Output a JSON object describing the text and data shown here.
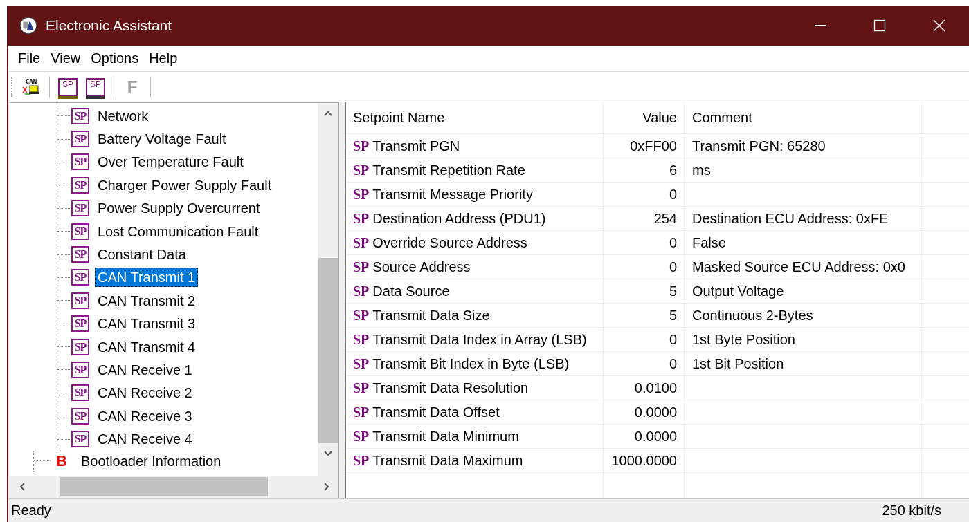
{
  "window": {
    "title": "Electronic Assistant"
  },
  "menu": [
    "File",
    "View",
    "Options",
    "Help"
  ],
  "toolbar": [
    {
      "kind": "connect",
      "label": "CAN",
      "disabled": false
    },
    {
      "kind": "open",
      "label": "SP",
      "disabled": false
    },
    {
      "kind": "save",
      "label": "SP",
      "disabled": false
    },
    {
      "kind": "letter",
      "label": "F",
      "disabled": true
    }
  ],
  "tree": {
    "items": [
      {
        "children": [
          {
            "badge": "SP",
            "kind": "setpoint",
            "label": "Network",
            "selected": false
          },
          {
            "badge": "SP",
            "kind": "setpoint",
            "label": "Battery Voltage Fault",
            "selected": false
          },
          {
            "badge": "SP",
            "kind": "setpoint",
            "label": "Over Temperature Fault",
            "selected": false
          },
          {
            "badge": "SP",
            "kind": "setpoint",
            "label": "Charger Power Supply Fault",
            "selected": false
          },
          {
            "badge": "SP",
            "kind": "setpoint",
            "label": "Power Supply Overcurrent",
            "selected": false
          },
          {
            "badge": "SP",
            "kind": "setpoint",
            "label": "Lost Communication Fault",
            "selected": false
          },
          {
            "badge": "SP",
            "kind": "setpoint",
            "label": "Constant Data",
            "selected": false
          },
          {
            "badge": "SP",
            "kind": "setpoint",
            "label": "CAN Transmit 1",
            "selected": true
          },
          {
            "badge": "SP",
            "kind": "setpoint",
            "label": "CAN Transmit 2",
            "selected": false
          },
          {
            "badge": "SP",
            "kind": "setpoint",
            "label": "CAN Transmit 3",
            "selected": false
          },
          {
            "badge": "SP",
            "kind": "setpoint",
            "label": "CAN Transmit 4",
            "selected": false
          },
          {
            "badge": "SP",
            "kind": "setpoint",
            "label": "CAN Receive 1",
            "selected": false
          },
          {
            "badge": "SP",
            "kind": "setpoint",
            "label": "CAN Receive 2",
            "selected": false
          },
          {
            "badge": "SP",
            "kind": "setpoint",
            "label": "CAN Receive 3",
            "selected": false
          },
          {
            "badge": "SP",
            "kind": "setpoint",
            "label": "CAN Receive 4",
            "selected": false
          }
        ]
      },
      {
        "badge": "B",
        "kind": "bootloader",
        "label": "Bootloader Information",
        "selected": false
      }
    ]
  },
  "table": {
    "columns": [
      "Setpoint Name",
      "Value",
      "Comment"
    ],
    "rows": [
      {
        "badge": "SP",
        "name": "Transmit PGN",
        "value": "0xFF00",
        "comment": "Transmit PGN: 65280"
      },
      {
        "badge": "SP",
        "name": "Transmit Repetition Rate",
        "value": "6",
        "comment": "ms"
      },
      {
        "badge": "SP",
        "name": "Transmit Message Priority",
        "value": "0"
      },
      {
        "badge": "SP",
        "name": "Destination Address (PDU1)",
        "value": "254",
        "comment": "Destination ECU Address: 0xFE"
      },
      {
        "badge": "SP",
        "name": "Override Source Address",
        "value": "0",
        "comment": "False"
      },
      {
        "badge": "SP",
        "name": "Source Address",
        "value": "0",
        "comment": "Masked Source ECU Address: 0x0"
      },
      {
        "badge": "SP",
        "name": "Data Source",
        "value": "5",
        "comment": "Output Voltage"
      },
      {
        "badge": "SP",
        "name": "Transmit Data Size",
        "value": "5",
        "comment": "Continuous 2-Bytes"
      },
      {
        "badge": "SP",
        "name": "Transmit Data Index in Array (LSB)",
        "value": "0",
        "comment": "1st Byte Position"
      },
      {
        "badge": "SP",
        "name": "Transmit Bit Index in Byte (LSB)",
        "value": "0",
        "comment": "1st Bit Position"
      },
      {
        "badge": "SP",
        "name": "Transmit Data Resolution",
        "value": "0.0100"
      },
      {
        "badge": "SP",
        "name": "Transmit Data Offset",
        "value": "0.0000"
      },
      {
        "badge": "SP",
        "name": "Transmit Data Minimum",
        "value": "0.0000"
      },
      {
        "badge": "SP",
        "name": "Transmit Data Maximum",
        "value": "1000.0000"
      }
    ]
  },
  "status_bar": {
    "message": "Ready",
    "bitrate": "250 kbit/s"
  }
}
